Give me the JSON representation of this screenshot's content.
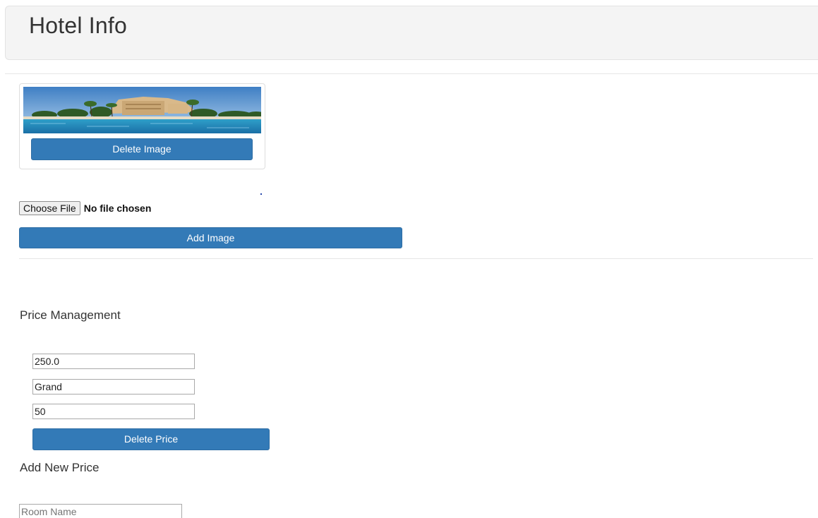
{
  "header": {
    "title": "Hotel Info"
  },
  "images": {
    "thumbnail_icon": "hotel-pool-photo",
    "delete_label": "Delete Image",
    "file_button_label": "Choose File",
    "file_status": "No file chosen",
    "add_label": "Add Image"
  },
  "prices": {
    "section_title": "Price Management",
    "entry": {
      "price": "250.0",
      "room": "Grand",
      "quantity": "50"
    },
    "delete_label": "Delete Price"
  },
  "new_price": {
    "section_title": "Add New Price",
    "room_name_placeholder": "Room Name"
  },
  "colors": {
    "primary": "#337ab7",
    "primary_border": "#2e6da4",
    "header_bg": "#f4f4f4"
  }
}
